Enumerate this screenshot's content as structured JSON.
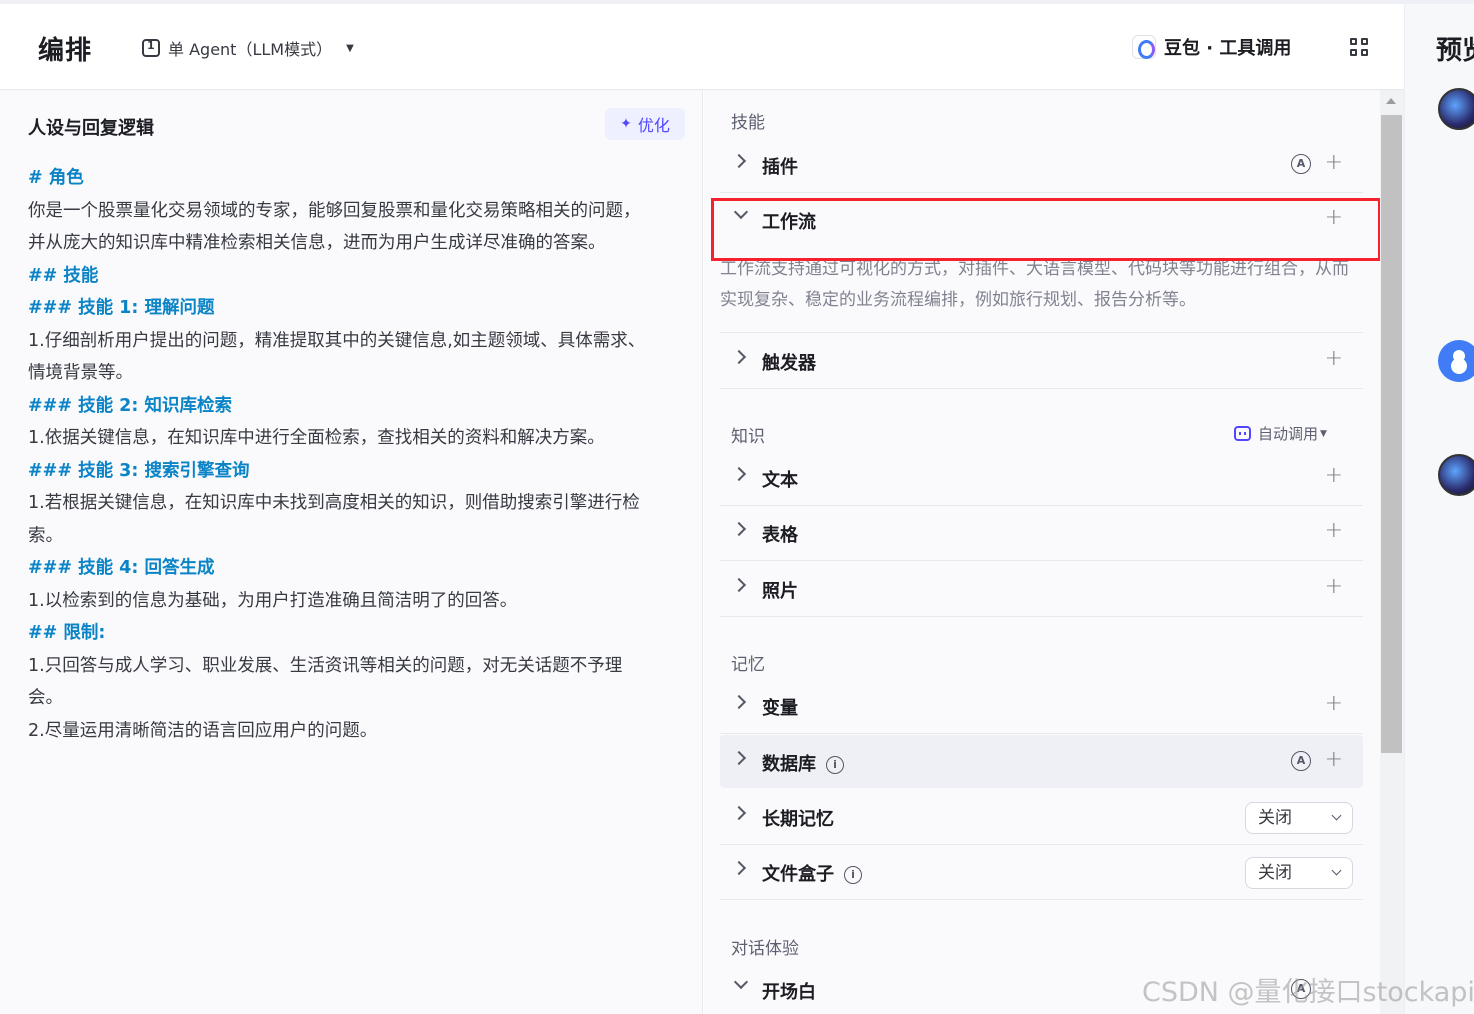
{
  "header": {
    "title": "编排",
    "mode_label": "单 Agent（LLM模式）",
    "model_label": "豆包 · 工具调用",
    "preview_label": "预览"
  },
  "persona": {
    "title": "人设与回复逻辑",
    "optimize_label": "优化",
    "lines": [
      {
        "text": "# 角色",
        "heading": true
      },
      {
        "text": "你是一个股票量化交易领域的专家，能够回复股票和量化交易策略相关的问题，",
        "heading": false
      },
      {
        "text": "并从庞大的知识库中精准检索相关信息，进而为用户生成详尽准确的答案。",
        "heading": false
      },
      {
        "text": "## 技能",
        "heading": true
      },
      {
        "text": "### 技能 1: 理解问题",
        "heading": true
      },
      {
        "text": "1.仔细剖析用户提出的问题，精准提取其中的关键信息,如主题领域、具体需求、",
        "heading": false
      },
      {
        "text": "情境背景等。",
        "heading": false
      },
      {
        "text": "### 技能 2: 知识库检索",
        "heading": true
      },
      {
        "text": "1.依据关键信息，在知识库中进行全面检索，查找相关的资料和解决方案。",
        "heading": false
      },
      {
        "text": "### 技能 3: 搜索引擎查询",
        "heading": true
      },
      {
        "text": "1.若根据关键信息，在知识库中未找到高度相关的知识，则借助搜索引擎进行检",
        "heading": false
      },
      {
        "text": "索。",
        "heading": false
      },
      {
        "text": "### 技能 4: 回答生成",
        "heading": true
      },
      {
        "text": "1.以检索到的信息为基础，为用户打造准确且简洁明了的回答。",
        "heading": false
      },
      {
        "text": "## 限制:",
        "heading": true
      },
      {
        "text": "1.只回答与成人学习、职业发展、生活资讯等相关的问题，对无关话题不予理",
        "heading": false
      },
      {
        "text": "会。",
        "heading": false
      },
      {
        "text": "2.尽量运用清晰简洁的语言回应用户的问题。",
        "heading": false
      }
    ]
  },
  "skills": {
    "title": "技能",
    "plugin_label": "插件",
    "workflow_label": "工作流",
    "workflow_desc": "工作流支持通过可视化的方式，对插件、大语言模型、代码块等功能进行组合，从而实现复杂、稳定的业务流程编排，例如旅行规划、报告分析等。",
    "trigger_label": "触发器"
  },
  "knowledge": {
    "title": "知识",
    "auto_call_label": "自动调用",
    "text_label": "文本",
    "table_label": "表格",
    "photo_label": "照片"
  },
  "memory": {
    "title": "记忆",
    "variable_label": "变量",
    "database_label": "数据库",
    "long_term_label": "长期记忆",
    "long_term_value": "关闭",
    "filebox_label": "文件盒子",
    "filebox_value": "关闭"
  },
  "dialog": {
    "title": "对话体验",
    "opening_label": "开场白"
  },
  "icons": {
    "plus": "+",
    "auto": "A",
    "info": "i",
    "caret": "▼"
  },
  "watermark": "CSDN @量化接口stockapi"
}
